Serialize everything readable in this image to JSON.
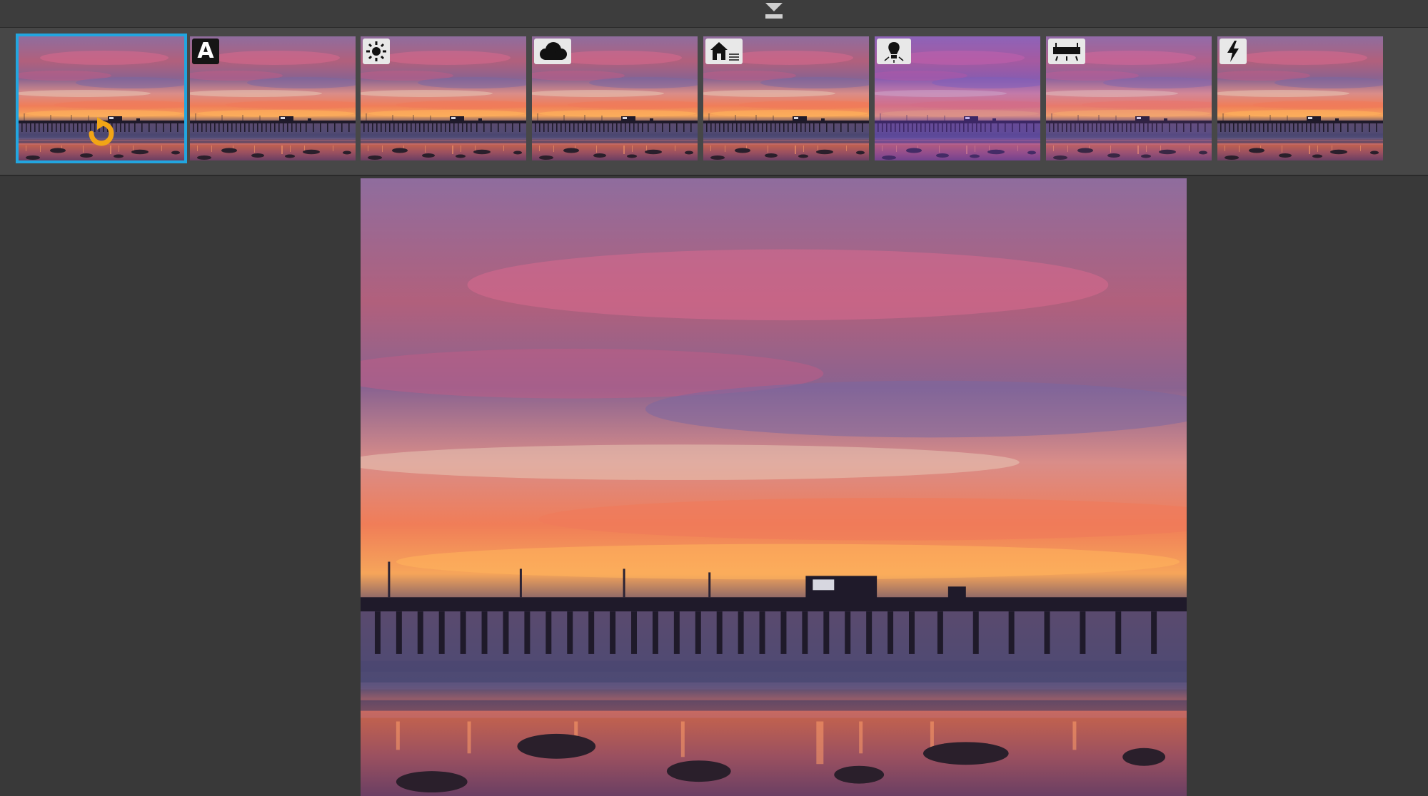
{
  "app": {
    "collapse_handle_icon": "chevron-down-icon"
  },
  "filmstrip": {
    "selected_index": 0,
    "thumbnails": [
      {
        "name": "original",
        "badge_icon": "revert-icon",
        "badge_style": "none",
        "tint": "normal"
      },
      {
        "name": "auto",
        "badge_text": "A",
        "badge_icon": "auto-letter-icon",
        "badge_style": "dark",
        "tint": "normal"
      },
      {
        "name": "sunny",
        "badge_icon": "sun-icon",
        "badge_style": "light",
        "tint": "normal"
      },
      {
        "name": "cloudy",
        "badge_icon": "cloud-icon",
        "badge_style": "light",
        "tint": "normal"
      },
      {
        "name": "shade",
        "badge_icon": "house-shade-icon",
        "badge_style": "light",
        "tint": "normal"
      },
      {
        "name": "tungsten",
        "badge_icon": "lightbulb-icon",
        "badge_style": "light",
        "tint": "purple"
      },
      {
        "name": "fluorescent",
        "badge_icon": "fluorescent-tube-icon",
        "badge_style": "light",
        "tint": "pinkish"
      },
      {
        "name": "flash",
        "badge_icon": "flash-icon",
        "badge_style": "light",
        "tint": "normal"
      }
    ]
  },
  "colors": {
    "selection": "#22a6e0",
    "background": "#393939",
    "filmstrip": "#474747",
    "revert": "#f2a516"
  }
}
